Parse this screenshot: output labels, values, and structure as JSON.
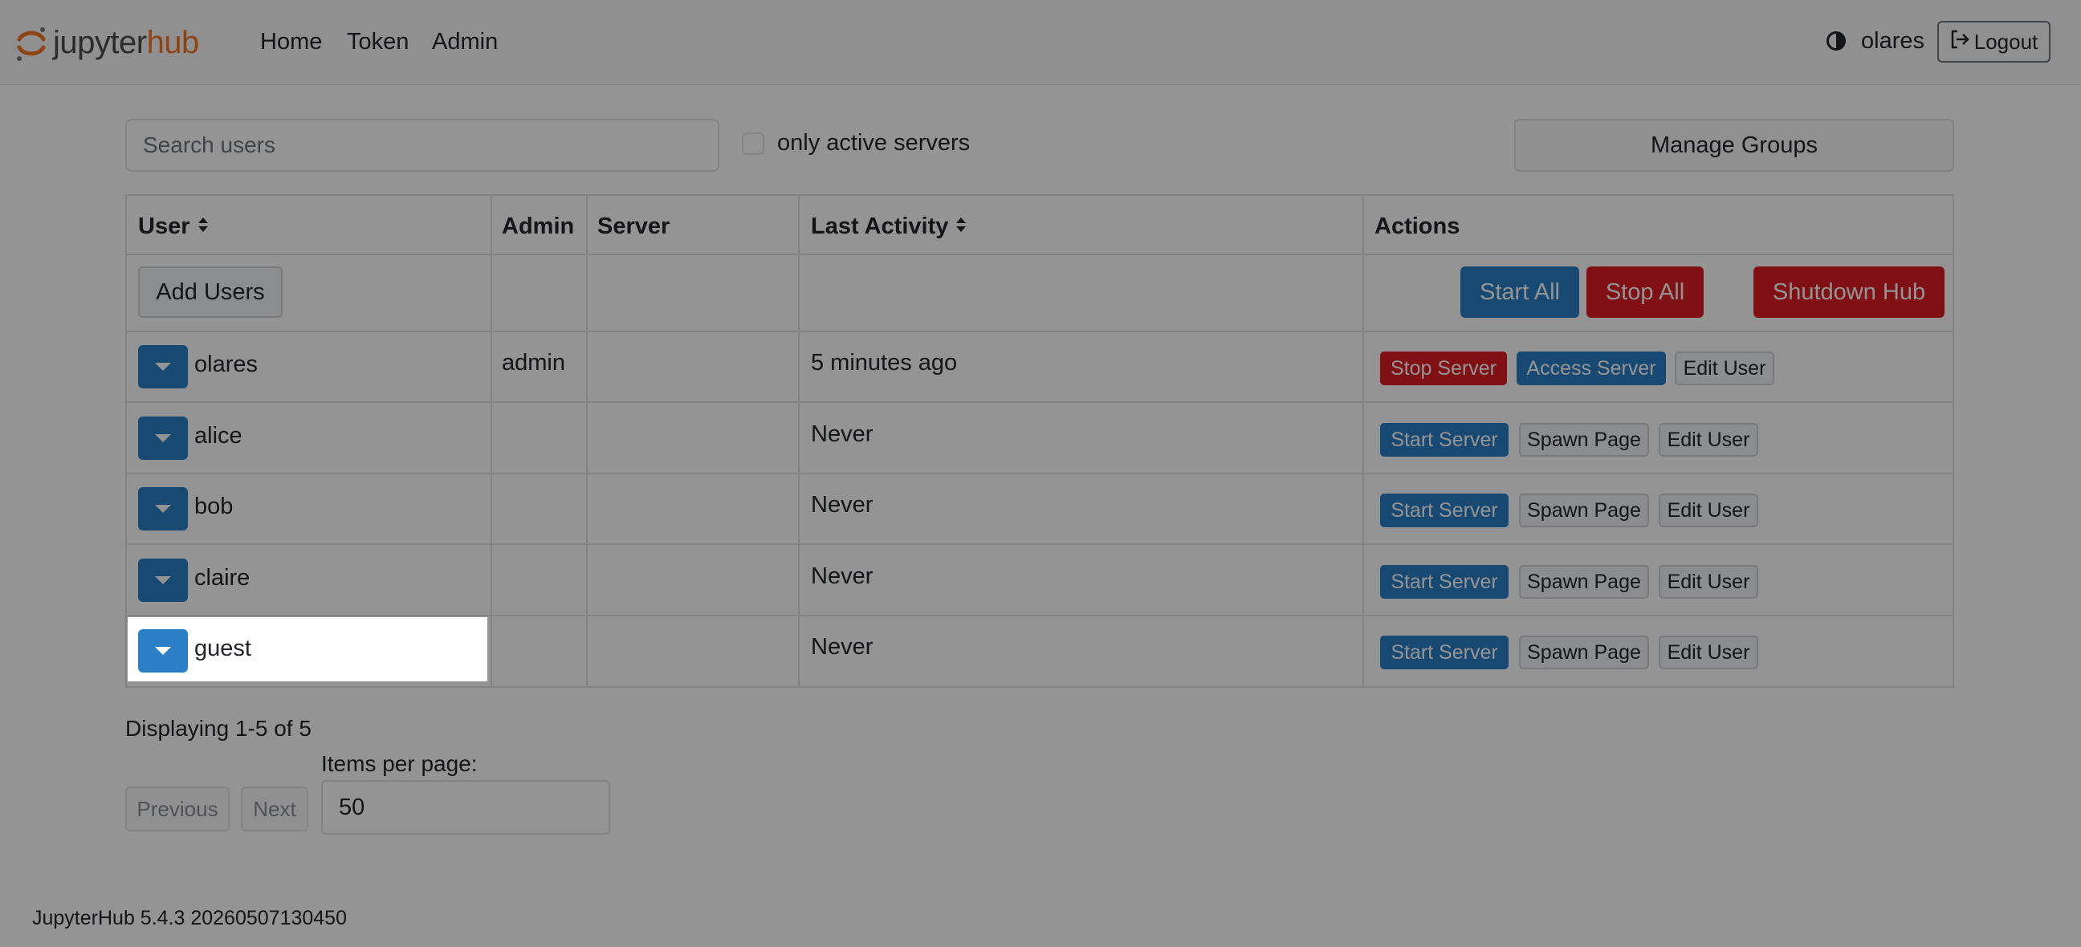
{
  "navbar": {
    "logo_word1": "jupyter",
    "logo_word2": "hub",
    "links": [
      "Home",
      "Token",
      "Admin"
    ],
    "username": "olares",
    "logout_label": "Logout"
  },
  "controls": {
    "search_placeholder": "Search users",
    "only_active_label": "only active servers",
    "manage_groups_label": "Manage Groups"
  },
  "table": {
    "headers": {
      "user": "User",
      "admin": "Admin",
      "server": "Server",
      "last_activity": "Last Activity",
      "actions": "Actions"
    },
    "add_users_label": "Add Users",
    "start_all_label": "Start All",
    "stop_all_label": "Stop All",
    "shutdown_hub_label": "Shutdown Hub",
    "rows": [
      {
        "name": "olares",
        "admin": "admin",
        "last_activity": "5 minutes ago",
        "actions": [
          "Stop Server",
          "Access Server",
          "Edit User"
        ]
      },
      {
        "name": "alice",
        "admin": "",
        "last_activity": "Never",
        "actions": [
          "Start Server",
          "Spawn Page",
          "Edit User"
        ]
      },
      {
        "name": "bob",
        "admin": "",
        "last_activity": "Never",
        "actions": [
          "Start Server",
          "Spawn Page",
          "Edit User"
        ]
      },
      {
        "name": "claire",
        "admin": "",
        "last_activity": "Never",
        "actions": [
          "Start Server",
          "Spawn Page",
          "Edit User"
        ]
      },
      {
        "name": "guest",
        "admin": "",
        "last_activity": "Never",
        "actions": [
          "Start Server",
          "Spawn Page",
          "Edit User"
        ]
      }
    ]
  },
  "pagination": {
    "displaying": "Displaying 1-5 of 5",
    "items_per_page_label": "Items per page:",
    "items_per_page_value": "50",
    "previous_label": "Previous",
    "next_label": "Next"
  },
  "footer": {
    "version": "JupyterHub 5.4.3 20260507130450"
  },
  "colors": {
    "primary": "#2a7fc6",
    "danger": "#dc1c22",
    "brand_orange": "#f37726"
  },
  "icons": [
    "jupyter-logo-icon",
    "theme-toggle-icon",
    "logout-icon",
    "sort-icon",
    "caret-down-icon"
  ]
}
